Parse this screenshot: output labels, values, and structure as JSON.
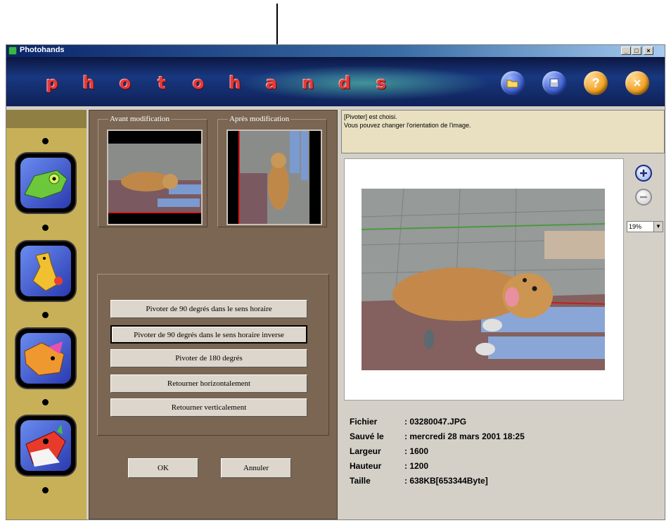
{
  "window": {
    "title": "Photohands",
    "controls": {
      "minimize": "_",
      "maximize": "□",
      "close": "×"
    }
  },
  "banner": {
    "logo_letters": [
      "p",
      "h",
      "o",
      "t",
      "o",
      "h",
      "a",
      "n",
      "d",
      "s"
    ],
    "buttons": [
      {
        "icon": "open-folder-icon",
        "color": "#3c5fd4"
      },
      {
        "icon": "save-disk-icon",
        "color": "#3c5fd4"
      },
      {
        "icon": "help-icon",
        "color": "#f0a020",
        "glyph": "?"
      },
      {
        "icon": "close-icon",
        "color": "#f0a020",
        "glyph": "×"
      }
    ]
  },
  "sidebar": {
    "tools": [
      {
        "icon": "chameleon-icon"
      },
      {
        "icon": "giraffe-icon"
      },
      {
        "icon": "fish-icon"
      },
      {
        "icon": "monster-icon"
      }
    ]
  },
  "panel": {
    "before_label": "Avant modification",
    "after_label": "Après modification",
    "actions": [
      "Pivoter de 90 degrés dans le sens horaire",
      "Pivoter de 90 degrés dans le sens horaire inverse",
      "Pivoter de 180 degrés",
      "Retourner horizontalement",
      "Retourner verticalement"
    ],
    "ok_label": "OK",
    "cancel_label": "Annuler"
  },
  "message": {
    "line1": "[Pivoter] est choisi.",
    "line2": "Vous pouvez changer l'orientation  de l'image."
  },
  "zoom": {
    "value": "19%"
  },
  "file_info": [
    {
      "key": "Fichier",
      "value": ": 03280047.JPG"
    },
    {
      "key": "Sauvé le",
      "value": ": mercredi 28 mars 2001 18:25"
    },
    {
      "key": "Largeur",
      "value": ": 1600"
    },
    {
      "key": "Hauteur",
      "value": ": 1200"
    },
    {
      "key": "Taille",
      "value": ": 638KB[653344Byte]"
    }
  ]
}
